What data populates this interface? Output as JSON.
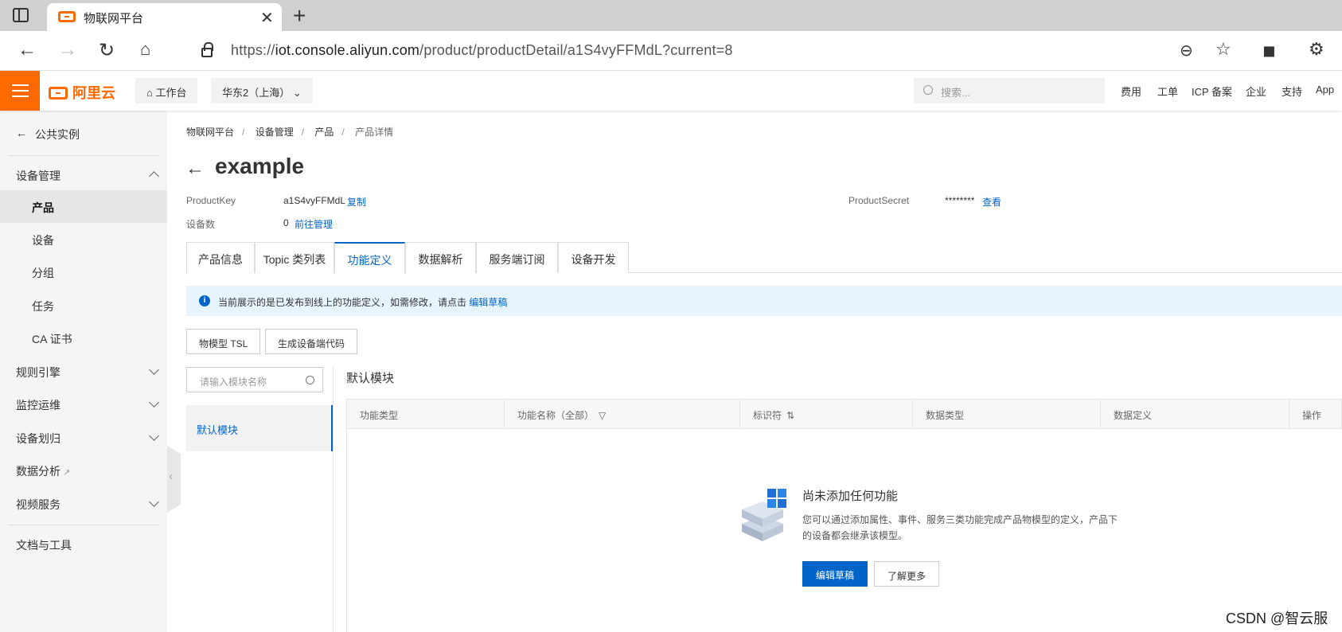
{
  "browser": {
    "tab_title": "物联网平台",
    "url_scheme": "https://",
    "url_host": "iot.console.aliyun.com",
    "url_path": "/product/productDetail/a1S4vyFFMdL?current=8"
  },
  "header": {
    "brand": "阿里云",
    "workbench": "工作台",
    "region": "华东2（上海）",
    "search_placeholder": "搜索...",
    "links": [
      "费用",
      "工单",
      "ICP 备案",
      "企业",
      "支持",
      "App"
    ]
  },
  "sidebar": {
    "back_label": "公共实例",
    "groups": [
      {
        "label": "设备管理",
        "expanded": true,
        "children": [
          "产品",
          "设备",
          "分组",
          "任务",
          "CA 证书"
        ]
      },
      {
        "label": "规则引擎"
      },
      {
        "label": "监控运维"
      },
      {
        "label": "设备划归"
      },
      {
        "label": "数据分析"
      },
      {
        "label": "视频服务"
      }
    ],
    "footer": "文档与工具",
    "active": "产品"
  },
  "breadcrumb": [
    "物联网平台",
    "设备管理",
    "产品",
    "产品详情"
  ],
  "page": {
    "title": "example",
    "product_key_label": "ProductKey",
    "product_key": "a1S4vyFFMdL",
    "copy_label": "复制",
    "product_secret_label": "ProductSecret",
    "product_secret": "********",
    "view_label": "查看",
    "device_count_label": "设备数",
    "device_count": "0",
    "manage_label": "前往管理"
  },
  "tabs": [
    "产品信息",
    "Topic 类列表",
    "功能定义",
    "数据解析",
    "服务端订阅",
    "设备开发"
  ],
  "active_tab": "功能定义",
  "notice": {
    "text": "当前展示的是已发布到线上的功能定义，如需修改，请点击",
    "link": "编辑草稿"
  },
  "actions": {
    "tsl": "物模型 TSL",
    "gen_code": "生成设备端代码"
  },
  "modules": {
    "search_placeholder": "请输入模块名称",
    "items": [
      "默认模块"
    ],
    "selected_title": "默认模块"
  },
  "table": {
    "columns": [
      "功能类型",
      "功能名称（全部）",
      "标识符",
      "数据类型",
      "数据定义",
      "操作"
    ]
  },
  "empty": {
    "title": "尚未添加任何功能",
    "desc_line1": "您可以通过添加属性、事件、服务三类功能完成产品物模型的定义，产品下",
    "desc_line2": "的设备都会继承该模型。",
    "primary": "编辑草稿",
    "secondary": "了解更多"
  },
  "watermark": "CSDN @智云服",
  "colors": {
    "brand": "#ff6a00",
    "link": "#0064c8",
    "notice_bg": "#e8f4fc"
  }
}
